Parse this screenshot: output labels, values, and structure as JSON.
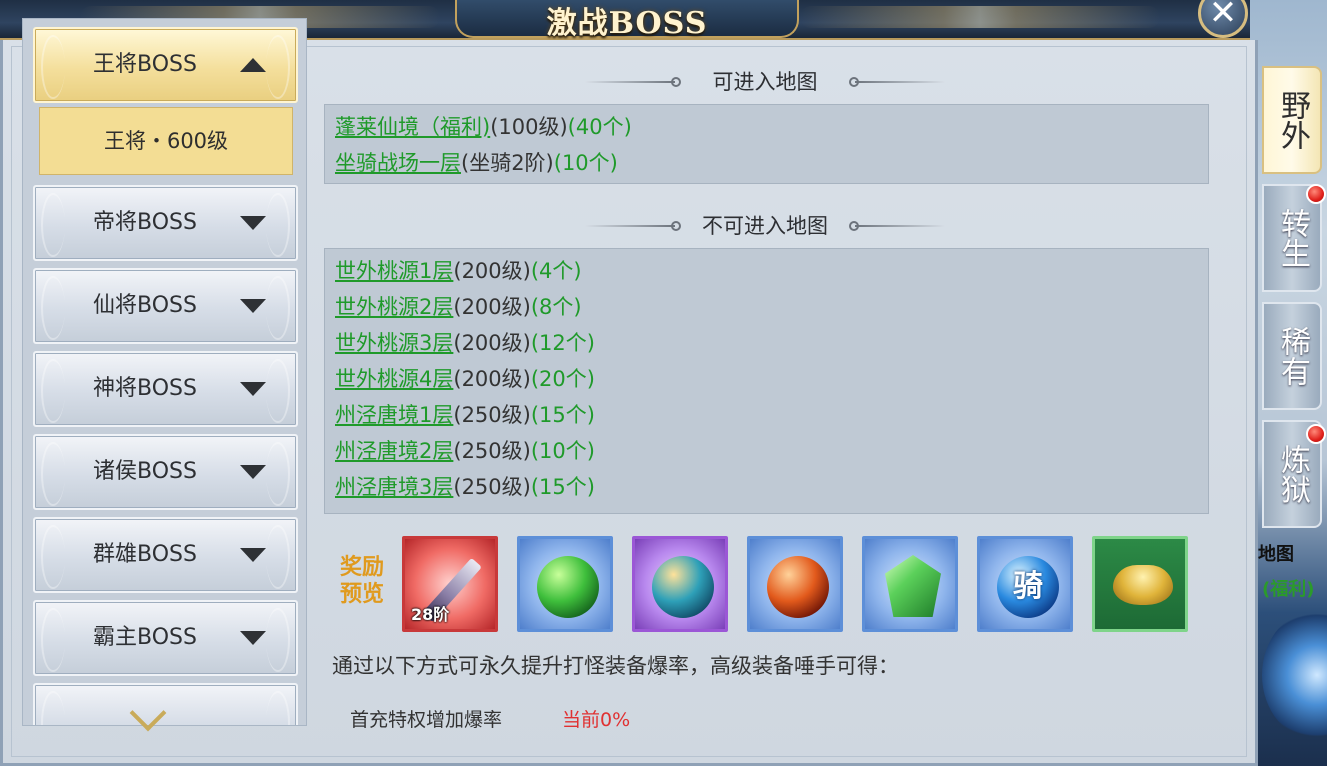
{
  "window": {
    "title": "激战BOSS",
    "close_label": "✕"
  },
  "boss_menu": {
    "items": [
      {
        "label": "王将BOSS",
        "expanded": true
      },
      {
        "label": "帝将BOSS",
        "expanded": false
      },
      {
        "label": "仙将BOSS",
        "expanded": false
      },
      {
        "label": "神将BOSS",
        "expanded": false
      },
      {
        "label": "诸侯BOSS",
        "expanded": false
      },
      {
        "label": "群雄BOSS",
        "expanded": false
      },
      {
        "label": "霸主BOSS",
        "expanded": false
      }
    ],
    "sub_item": "王将・600级"
  },
  "accessible_maps": {
    "heading": "可进入地图",
    "rows": [
      {
        "name": "蓬莱仙境（福利)",
        "level": "(100级)",
        "count": "(40个)"
      },
      {
        "name": "坐骑战场一层",
        "level": "(坐骑2阶)",
        "count": "(10个)"
      }
    ]
  },
  "inaccessible_maps": {
    "heading": "不可进入地图",
    "rows": [
      {
        "name": "世外桃源1层",
        "level": "(200级)",
        "count": "(4个)"
      },
      {
        "name": "世外桃源2层",
        "level": "(200级)",
        "count": "(8个)"
      },
      {
        "name": "世外桃源3层",
        "level": "(200级)",
        "count": "(12个)"
      },
      {
        "name": "世外桃源4层",
        "level": "(200级)",
        "count": "(20个)"
      },
      {
        "name": "州泾唐境1层",
        "level": "(250级)",
        "count": "(15个)"
      },
      {
        "name": "州泾唐境2层",
        "level": "(250级)",
        "count": "(10个)"
      },
      {
        "name": "州泾唐境3层",
        "level": "(250级)",
        "count": "(15个)"
      }
    ]
  },
  "rewards": {
    "label_line1": "奖励",
    "label_line2": "预览",
    "items": [
      {
        "icon": "sword-icon",
        "frame": "red",
        "tag": "28阶"
      },
      {
        "icon": "green-orb-icon",
        "frame": "blue"
      },
      {
        "icon": "teal-orb-icon",
        "frame": "purple"
      },
      {
        "icon": "fire-orb-icon",
        "frame": "blue"
      },
      {
        "icon": "green-gem-icon",
        "frame": "blue"
      },
      {
        "icon": "mount-orb-icon",
        "frame": "blue",
        "char": "骑"
      },
      {
        "icon": "gold-ingot-icon",
        "frame": "green"
      }
    ]
  },
  "info_text": "通过以下方式可永久提升打怪装备爆率，高级装备唾手可得：",
  "privilege": {
    "label": "首充特权增加爆率",
    "value": "当前0%"
  },
  "side_tabs": [
    {
      "label": "野外",
      "active": true,
      "badge": false
    },
    {
      "label": "转生",
      "active": false,
      "badge": true
    },
    {
      "label": "稀有",
      "active": false,
      "badge": false
    },
    {
      "label": "炼狱",
      "active": false,
      "badge": true
    }
  ],
  "background_text": {
    "line1": "地图",
    "line2": "(福利)"
  },
  "colors": {
    "link_green": "#1f9a2a",
    "reward_label": "#e09a1e",
    "alert_red": "#e03131",
    "active_gold": "#f4df9c"
  }
}
